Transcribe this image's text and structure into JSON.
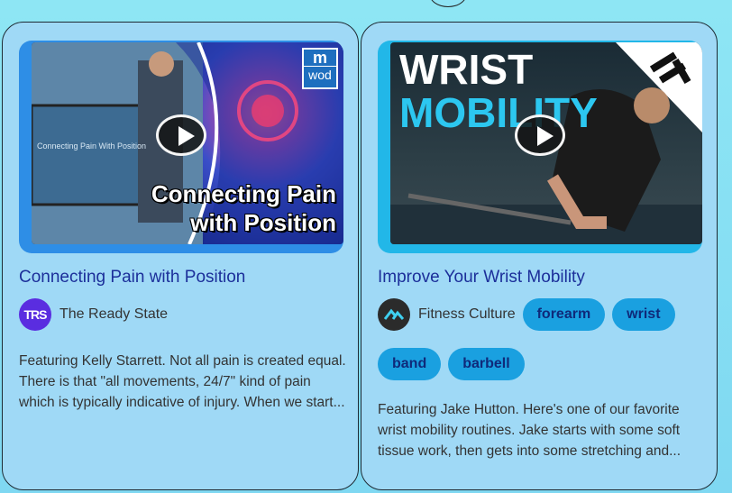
{
  "cards": [
    {
      "title": "Connecting Pain with Position",
      "thumbnail": {
        "overlay_line1": "Connecting Pain",
        "overlay_line2": "with Position",
        "logo_top": "m",
        "logo_bottom": "wod",
        "screen_text": "Connecting Pain With Position"
      },
      "author": {
        "name": "The Ready State",
        "avatar_text": "TRS"
      },
      "description": "Featuring Kelly Starrett. Not all pain is created equal. There is that \"all movements, 24/7\" kind of pain which is typically indicative of injury. When we start..."
    },
    {
      "title": "Improve Your Wrist Mobility",
      "thumbnail": {
        "overlay_line1": "WRIST",
        "overlay_line2": "MOBILITY"
      },
      "author": {
        "name": "Fitness Culture"
      },
      "tags": [
        "forearm",
        "wrist",
        "band",
        "barbell"
      ],
      "description": "Featuring Jake Hutton. Here's one of our favorite wrist mobility routines. Jake starts with some soft tissue work, then gets into some stretching and..."
    }
  ],
  "colors": {
    "title": "#1c2f9a",
    "tag_bg": "#1aa0e0",
    "card_bg": "#9fd9f6"
  }
}
